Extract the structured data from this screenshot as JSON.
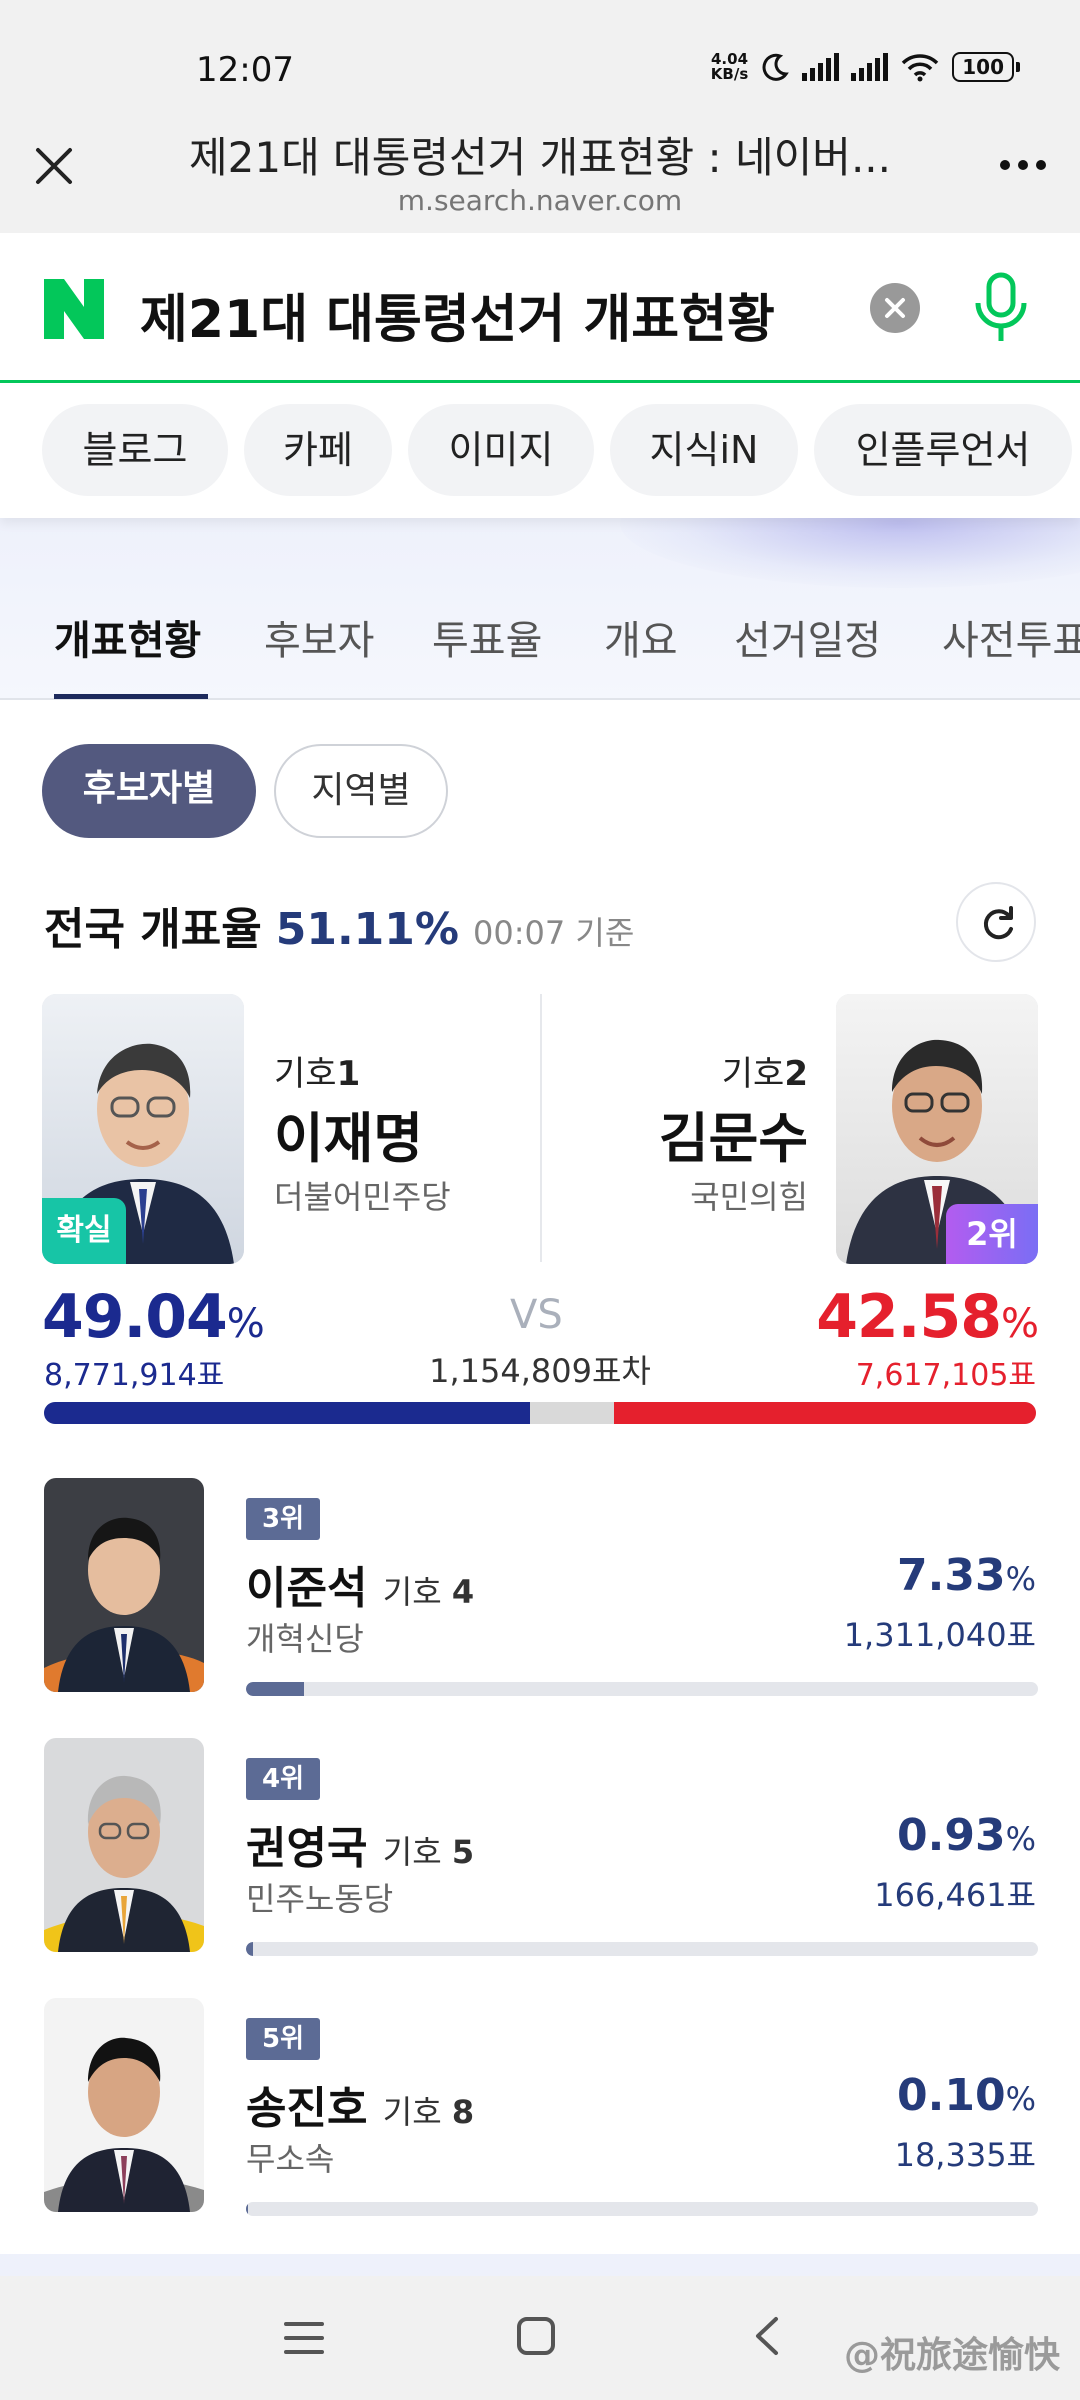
{
  "status_bar": {
    "time": "12:07",
    "net_speed_top": "4.04",
    "net_speed_bottom": "KB/s",
    "battery": "100"
  },
  "browser": {
    "page_title": "제21대 대통령선거 개표현황 : 네이버...",
    "url": "m.search.naver.com"
  },
  "search": {
    "logo": "N",
    "query": "제21대 대통령선거 개표현황",
    "brand_color": "#03c75a"
  },
  "categories": [
    "블로그",
    "카페",
    "이미지",
    "지식iN",
    "인플루언서"
  ],
  "tabs": [
    "개표현황",
    "후보자",
    "투표율",
    "개요",
    "선거일정",
    "사전투표"
  ],
  "filters": {
    "by_candidate": "후보자별",
    "by_region": "지역별"
  },
  "nationwide": {
    "label": "전국 개표율",
    "rate": "51.11%",
    "as_of": "00:07 기준"
  },
  "top_two": {
    "vs": "VS",
    "difference": "1,154,809표차",
    "left": {
      "number_label": "기호",
      "number": "1",
      "name": "이재명",
      "party": "더불어민주당",
      "badge": "확실",
      "percent": "49.04",
      "percent_unit": "%",
      "votes": "8,771,914표",
      "share": 49.04,
      "color": "#1b2a8f"
    },
    "right": {
      "number_label": "기호",
      "number": "2",
      "name": "김문수",
      "party": "국민의힘",
      "badge": "2위",
      "percent": "42.58",
      "percent_unit": "%",
      "votes": "7,617,105표",
      "share": 42.58,
      "color": "#e5202d"
    }
  },
  "others": [
    {
      "rank": "3위",
      "name": "이준석",
      "number_label": "기호",
      "number": "4",
      "party": "개혁신당",
      "percent": "7.33",
      "percent_unit": "%",
      "votes": "1,311,040표",
      "share": 7.33
    },
    {
      "rank": "4위",
      "name": "권영국",
      "number_label": "기호",
      "number": "5",
      "party": "민주노동당",
      "percent": "0.93",
      "percent_unit": "%",
      "votes": "166,461표",
      "share": 0.93
    },
    {
      "rank": "5위",
      "name": "송진호",
      "number_label": "기호",
      "number": "8",
      "party": "무소속",
      "percent": "0.10",
      "percent_unit": "%",
      "votes": "18,335표",
      "share": 0.1
    }
  ],
  "watermark": "@祝旅途愉快",
  "icons": {
    "close": "close-icon",
    "more": "more-icon",
    "clear": "clear-icon",
    "mic": "microphone-icon",
    "refresh": "refresh-icon",
    "menu": "menu-icon",
    "home": "home-icon",
    "back": "back-icon"
  }
}
